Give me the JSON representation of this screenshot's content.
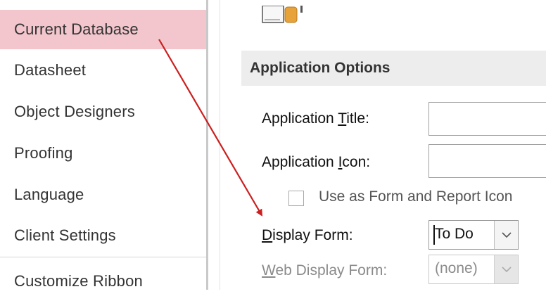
{
  "sidebar": {
    "items": [
      {
        "label": "Current Database",
        "selected": true
      },
      {
        "label": "Datasheet"
      },
      {
        "label": "Object Designers"
      },
      {
        "label": "Proofing"
      },
      {
        "label": "Language"
      },
      {
        "label": "Client Settings"
      },
      {
        "label": "Customize Ribbon"
      }
    ]
  },
  "main": {
    "section_title": "Application Options",
    "app_title": {
      "pre": "Application ",
      "ul": "T",
      "post": "itle:",
      "value": ""
    },
    "app_icon": {
      "pre": "Application ",
      "ul": "I",
      "post": "con:",
      "value": ""
    },
    "use_as_icon": {
      "label": "Use as Form and Report Icon",
      "checked": false
    },
    "display_form": {
      "ul": "D",
      "post": "isplay Form:",
      "value": "To Do"
    },
    "web_display_form": {
      "ul": "W",
      "post": "eb Display Form:",
      "value": "(none)"
    }
  },
  "colors": {
    "selected_bg": "#f2c6cc",
    "annotation_arrow": "#cc1f1f",
    "section_bg": "#ededed"
  }
}
